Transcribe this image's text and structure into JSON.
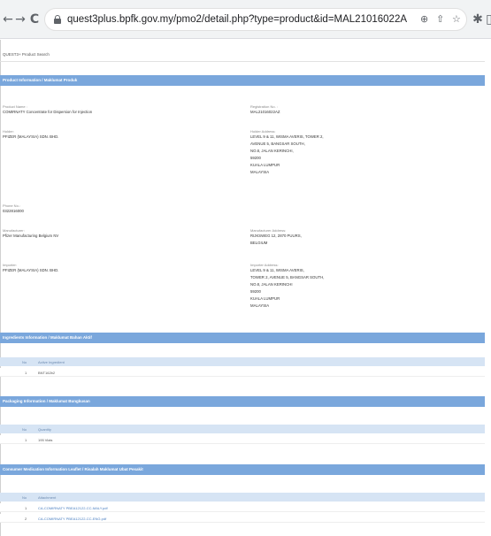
{
  "browser": {
    "url": "quest3plus.bpfk.gov.my/pmo2/detail.php?type=product&id=MAL21016022A"
  },
  "breadcrumb": "QUEST3+ Product Search",
  "section1": {
    "title": "Product Information / Maklumat Produk",
    "product_name_label": "Product Name :",
    "product_name": "COMIRNATY Concentrate for Dispersion for Injection",
    "registration_label": "Registration No. :",
    "registration_no": "MAL21016022AZ",
    "holder_label": "Holder:",
    "holder": "PFIZER (MALAYSIA) SDN. BHD.",
    "holder_address_label": "Holder Address:",
    "holder_address": [
      "LEVEL 9 & 11, WISMA AVERIS, TOWER 2,",
      "AVENUE 5, BANGSAR SOUTH,",
      "NO.8, JALAN KERINCHI,",
      "59200",
      "KUALA LUMPUR",
      "MALAYSIA"
    ],
    "phone_label": "Phone No.:",
    "phone": "0322816000",
    "manufacturer_label": "Manufacturer:",
    "manufacturer": "Pfizer Manufacturing Belgium NV",
    "manufacturer_address_label": "Manufacturer Address:",
    "manufacturer_address": [
      "RIJKSWEG 12, 2870 PUURS,",
      "BELGIUM"
    ],
    "importer_label": "Importer:",
    "importer": "PFIZER (MALAYSIA) SDN. BHD.",
    "importer_address_label": "Importer Address:",
    "importer_address": [
      "LEVEL 9 & 11, WISMA AVERIS,",
      "TOWER 2, AVENUE 5, BANGSAR SOUTH,",
      "NO.8, JALAN KERINCHI",
      "59200",
      "KUALA LUMPUR",
      "MALAYSIA"
    ]
  },
  "section2": {
    "title": "Ingredients Information / Maklumat Bahan Aktif",
    "col_no": "No",
    "col_name": "Active Ingredient",
    "rows": [
      {
        "no": "1",
        "name": "BNT162b2"
      }
    ]
  },
  "section3": {
    "title": "Packaging Information / Maklumat Bungkusan",
    "col_no": "No",
    "col_name": "Quantity",
    "rows": [
      {
        "no": "1",
        "name": "195 Vials"
      }
    ]
  },
  "section4": {
    "title": "Consumer Medication Information Leaflet / Risalah Maklumat Ubat Pesakit",
    "col_no": "No",
    "col_name": "Attachment",
    "rows": [
      {
        "no": "1",
        "name": "CA-COMIRNATY PBEA12122-CC-MALY.pdf"
      },
      {
        "no": "2",
        "name": "CA-COMIRNATY PBEA12122-CC-ENG.pdf"
      }
    ]
  }
}
